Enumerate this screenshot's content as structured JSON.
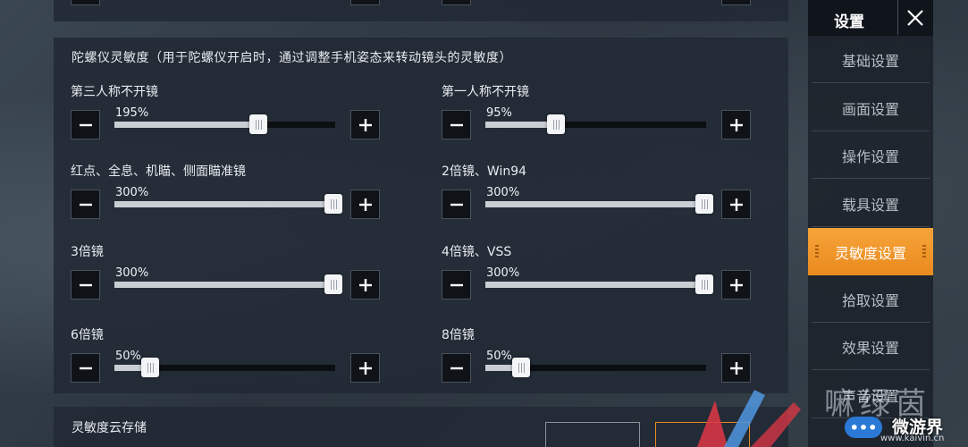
{
  "section": {
    "title": "陀螺仪灵敏度（用于陀螺仪开启时，通过调整手机姿态来转动镜头的灵敏度）"
  },
  "settings": [
    {
      "label": "第三人称不开镜",
      "value_text": "195%",
      "level": 0.65
    },
    {
      "label": "第一人称不开镜",
      "value_text": "95%",
      "level": 0.32
    },
    {
      "label": "红点、全息、机瞄、侧面瞄准镜",
      "value_text": "300%",
      "level": 1.0
    },
    {
      "label": "2倍镜、Win94",
      "value_text": "300%",
      "level": 1.0
    },
    {
      "label": "3倍镜",
      "value_text": "300%",
      "level": 1.0
    },
    {
      "label": "4倍镜、VSS",
      "value_text": "300%",
      "level": 1.0
    },
    {
      "label": "6倍镜",
      "value_text": "50%",
      "level": 0.16
    },
    {
      "label": "8倍镜",
      "value_text": "50%",
      "level": 0.16
    }
  ],
  "bottom": {
    "label": "灵敏度云存储"
  },
  "sidebar": {
    "title": "设置",
    "items": [
      {
        "label": "基础设置",
        "active": false
      },
      {
        "label": "画面设置",
        "active": false
      },
      {
        "label": "操作设置",
        "active": false
      },
      {
        "label": "载具设置",
        "active": false
      },
      {
        "label": "灵敏度设置",
        "active": true
      },
      {
        "label": "拾取设置",
        "active": false
      },
      {
        "label": "效果设置",
        "active": false
      },
      {
        "label": "声音设置",
        "active": false
      }
    ]
  },
  "watermark": {
    "text": "嘛绿茵",
    "site": "微游界",
    "url": "www.kaivin.cn",
    "badge": "•••"
  },
  "colors": {
    "accent": "#f39a2e",
    "panel": "#212934",
    "track": "#0c0f12",
    "fill": "#c9ced3"
  }
}
